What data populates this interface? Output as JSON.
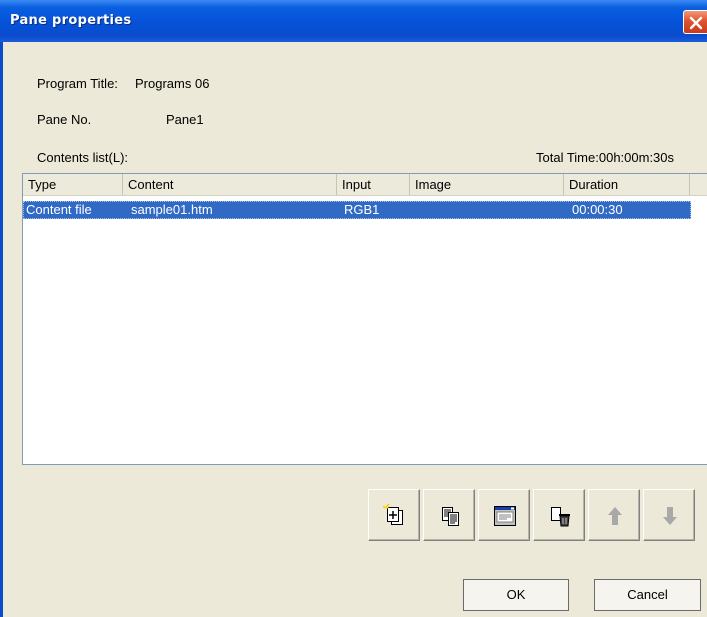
{
  "window": {
    "title": "Pane properties"
  },
  "info": {
    "program_title_label": "Program Title:",
    "program_title_value": "Programs 06",
    "pane_no_label": "Pane No.",
    "pane_no_value": "Pane1",
    "contents_list_label": "Contents list(L):",
    "total_time": "Total Time:00h:00m:30s"
  },
  "table": {
    "columns": [
      "Type",
      "Content",
      "Input",
      "Image",
      "Duration"
    ],
    "rows": [
      {
        "type": "Content file",
        "content": "sample01.htm",
        "input": "RGB1",
        "image": "",
        "duration": "00:00:30",
        "selected": true
      }
    ]
  },
  "toolbar": {
    "buttons": [
      {
        "icon": "add-content-icon",
        "enabled": true
      },
      {
        "icon": "copy-icon",
        "enabled": true
      },
      {
        "icon": "properties-window-icon",
        "enabled": true
      },
      {
        "icon": "delete-icon",
        "enabled": true
      },
      {
        "icon": "arrow-up-icon",
        "enabled": false
      },
      {
        "icon": "arrow-down-icon",
        "enabled": false
      }
    ]
  },
  "buttons": {
    "ok": "OK",
    "cancel": "Cancel"
  },
  "colors": {
    "titlebar": "#0551d9",
    "selection": "#316ac5",
    "dialog_bg": "#ece9d8",
    "close": "#e0532f"
  }
}
